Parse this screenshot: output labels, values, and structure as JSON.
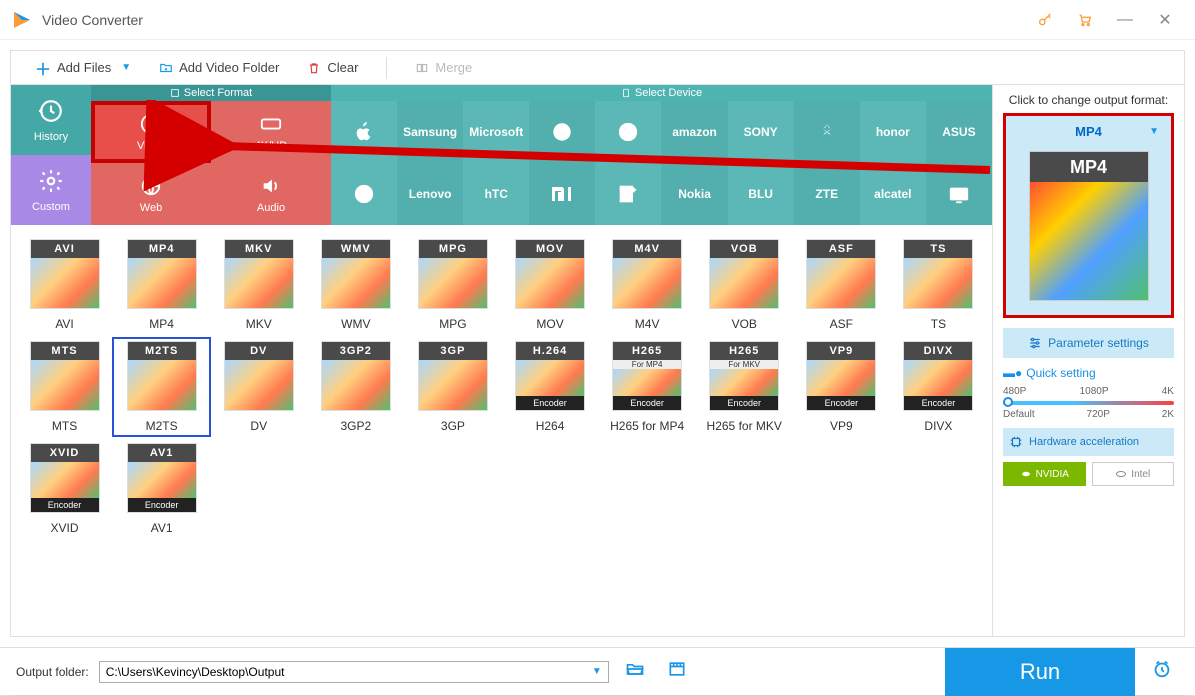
{
  "titlebar": {
    "title": "Video Converter"
  },
  "toolbar": {
    "addFiles": "Add Files",
    "addFolder": "Add Video Folder",
    "clear": "Clear",
    "merge": "Merge"
  },
  "side": {
    "history": "History",
    "custom": "Custom"
  },
  "catHeaders": {
    "format": "Select Format",
    "device": "Select Device"
  },
  "categories": {
    "video": "Video",
    "fourkhd": "4K/HD",
    "web": "Web",
    "audio": "Audio"
  },
  "brandsRow1": [
    "Apple",
    "Samsung",
    "Microsoft",
    "Google",
    "LG",
    "amazon",
    "SONY",
    "Huawei",
    "honor",
    "ASUS"
  ],
  "brandsRow2": [
    "Motorola",
    "Lenovo",
    "hTC",
    "Xiaomi",
    "OnePlus",
    "Nokia",
    "BLU",
    "ZTE",
    "alcatel",
    "TV"
  ],
  "formats": [
    {
      "code": "AVI",
      "label": "AVI"
    },
    {
      "code": "MP4",
      "label": "MP4"
    },
    {
      "code": "MKV",
      "label": "MKV"
    },
    {
      "code": "WMV",
      "label": "WMV"
    },
    {
      "code": "MPG",
      "label": "MPG"
    },
    {
      "code": "MOV",
      "label": "MOV"
    },
    {
      "code": "M4V",
      "label": "M4V"
    },
    {
      "code": "VOB",
      "label": "VOB"
    },
    {
      "code": "ASF",
      "label": "ASF"
    },
    {
      "code": "TS",
      "label": "TS"
    },
    {
      "code": "MTS",
      "label": "MTS"
    },
    {
      "code": "M2TS",
      "label": "M2TS",
      "selected": true
    },
    {
      "code": "DV",
      "label": "DV"
    },
    {
      "code": "3GP2",
      "label": "3GP2"
    },
    {
      "code": "3GP",
      "label": "3GP"
    },
    {
      "code": "H.264",
      "label": "H264",
      "badge": "Encoder"
    },
    {
      "code": "H265",
      "label": "H265 for MP4",
      "sub": "For MP4",
      "badge": "Encoder"
    },
    {
      "code": "H265",
      "label": "H265 for MKV",
      "sub": "For MKV",
      "badge": "Encoder"
    },
    {
      "code": "VP9",
      "label": "VP9",
      "badge": "Encoder"
    },
    {
      "code": "DIVX",
      "label": "DIVX",
      "badge": "Encoder"
    },
    {
      "code": "XVID",
      "label": "XVID",
      "badge": "Encoder"
    },
    {
      "code": "AV1",
      "label": "AV1",
      "badge": "Encoder"
    }
  ],
  "right": {
    "title": "Click to change output format:",
    "currentFormat": "MP4",
    "paramBtn": "Parameter settings",
    "quickHead": "Quick setting",
    "ticksTop": [
      "480P",
      "1080P",
      "4K"
    ],
    "ticksBot": [
      "Default",
      "720P",
      "2K"
    ],
    "hardAcc": "Hardware acceleration",
    "nvidia": "NVIDIA",
    "intel": "Intel"
  },
  "bottom": {
    "label": "Output folder:",
    "path": "C:\\Users\\Kevincy\\Desktop\\Output",
    "run": "Run"
  }
}
